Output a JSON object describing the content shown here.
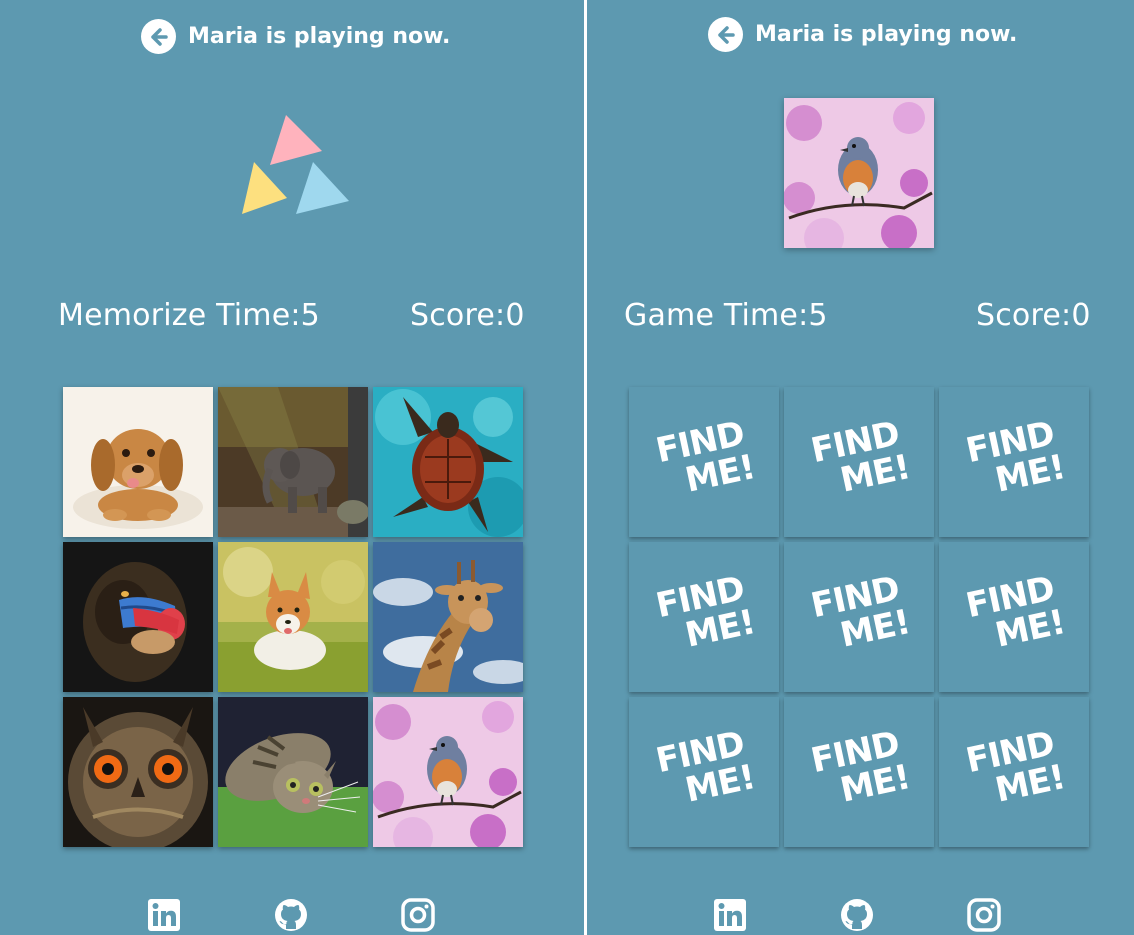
{
  "left_panel": {
    "header": {
      "title": "Maria is playing now.",
      "back_icon": "arrow-left-circle-icon"
    },
    "logo": {
      "icon": "triangles-logo",
      "colors": [
        "#ffb3bd",
        "#fde07f",
        "#9fd8ee"
      ]
    },
    "timer": "Memorize Time:5",
    "score": "Score:0",
    "cards": [
      {
        "image": "puppy-dachshund"
      },
      {
        "image": "baby-elephant"
      },
      {
        "image": "sea-turtle"
      },
      {
        "image": "mandrill"
      },
      {
        "image": "corgi"
      },
      {
        "image": "giraffe"
      },
      {
        "image": "owl"
      },
      {
        "image": "tabby-cat"
      },
      {
        "image": "robin-bird"
      }
    ]
  },
  "right_panel": {
    "header": {
      "title": "Maria is playing now.",
      "back_icon": "arrow-left-circle-icon"
    },
    "target_image": "robin-bird",
    "timer": "Game Time:5",
    "score": "Score:0",
    "card_label": {
      "line1": "FIND",
      "line2": "ME!"
    }
  },
  "footer": {
    "icons": [
      "linkedin-icon",
      "github-icon",
      "instagram-icon"
    ]
  },
  "colors": {
    "panel_bg": "#5d99b0",
    "divider": "#ffffff",
    "text": "#ffffff"
  }
}
